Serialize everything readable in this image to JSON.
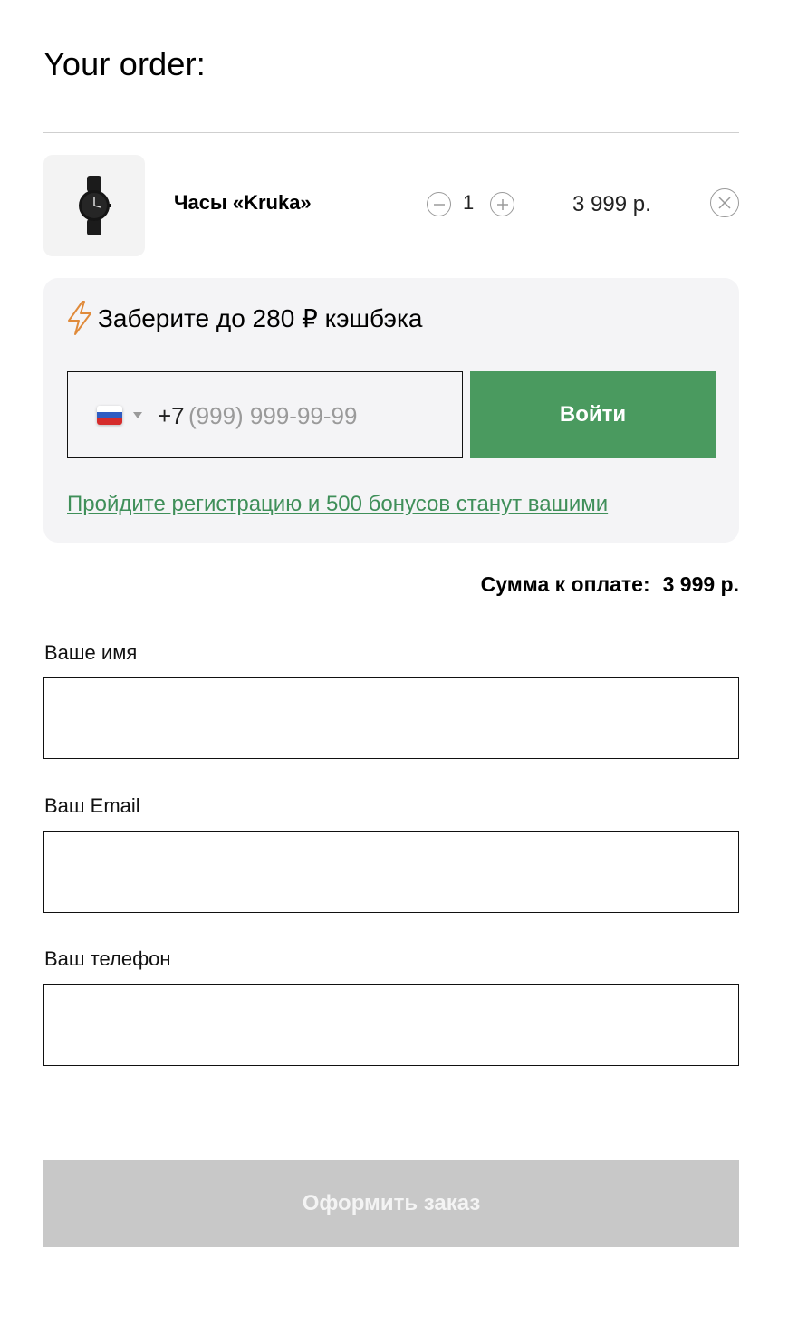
{
  "order": {
    "title": "Your order:",
    "item": {
      "name": "Часы «Kruka»",
      "quantity": "1",
      "price": "3 999 р.",
      "image_icon": "wristwatch-icon"
    }
  },
  "cashback": {
    "title": "Заберите до 280 ₽ кэшбэка",
    "icon": "lightning-icon",
    "phone_prefix": "+7",
    "phone_placeholder": "(999) 999-99-99",
    "country_flag": "russia-flag-icon",
    "login_button": "Войти",
    "register_link": "Пройдите регистрацию и 500 бонусов станут вашими"
  },
  "total": {
    "label": "Сумма к оплате:",
    "amount": "3 999 р."
  },
  "form": {
    "name_label": "Ваше имя",
    "email_label": "Ваш Email",
    "phone_label": "Ваш телефон",
    "name_value": "",
    "email_value": "",
    "phone_value": ""
  },
  "submit": {
    "label": "Оформить заказ"
  },
  "colors": {
    "accent_green": "#4a9a5f",
    "link_green": "#3f8f59",
    "panel_bg": "#f4f4f6",
    "disabled_button": "#c8c8c8",
    "bolt_orange": "#e08a3a"
  }
}
